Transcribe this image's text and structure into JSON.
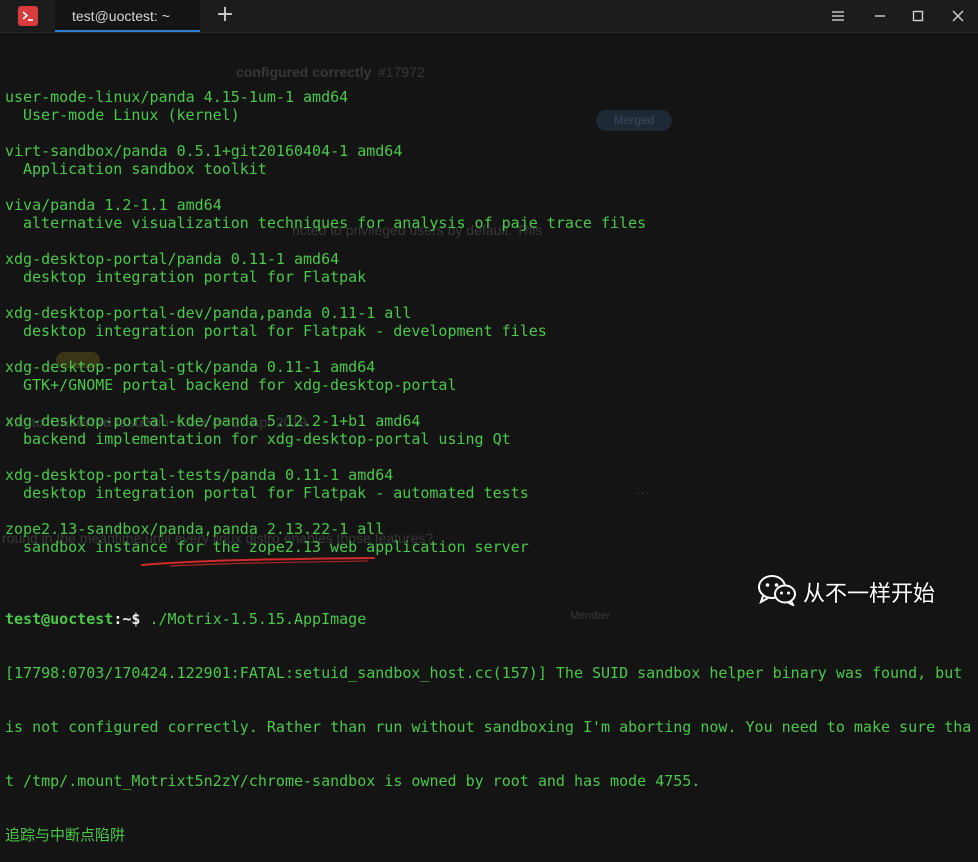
{
  "window": {
    "tab_title": "test@uoctest: ~",
    "new_tab_symbol": "+"
  },
  "background_page": {
    "issue_title_fragment": "configured correctly",
    "issue_number": "#17972",
    "merged_label": "Merged",
    "restricted_text": "ricted to privileged users by default. This",
    "tag_fragment": "5.0.x",
    "unsorted_text": "this to",
    "unsorted_bold": "Unsorted Issues",
    "in_text": "in",
    "date_text": "on 27 Apr 2019",
    "workaround_text": "round in the meantime until every linux distro enables those features?",
    "ellipsis": "···",
    "member_label": "Member"
  },
  "terminal": {
    "packages": [
      {
        "name": "user-mode-linux/panda 4.15-1um-1 amd64",
        "desc": "User-mode Linux (kernel)"
      },
      {
        "name": "virt-sandbox/panda 0.5.1+git20160404-1 amd64",
        "desc": "Application sandbox toolkit"
      },
      {
        "name": "viva/panda 1.2-1.1 amd64",
        "desc": "alternative visualization techniques for analysis of paje trace files"
      },
      {
        "name": "xdg-desktop-portal/panda 0.11-1 amd64",
        "desc": "desktop integration portal for Flatpak"
      },
      {
        "name": "xdg-desktop-portal-dev/panda,panda 0.11-1 all",
        "desc": "desktop integration portal for Flatpak - development files"
      },
      {
        "name": "xdg-desktop-portal-gtk/panda 0.11-1 amd64",
        "desc": "GTK+/GNOME portal backend for xdg-desktop-portal"
      },
      {
        "name": "xdg-desktop-portal-kde/panda 5.12.2-1+b1 amd64",
        "desc": "backend implementation for xdg-desktop-portal using Qt"
      },
      {
        "name": "xdg-desktop-portal-tests/panda 0.11-1 amd64",
        "desc": "desktop integration portal for Flatpak - automated tests"
      },
      {
        "name": "zope2.13-sandbox/panda,panda 2.13.22-1 all",
        "desc": "sandbox instance for the zope2.13 web application server"
      }
    ],
    "prompt_user": "test@uoctest",
    "prompt_rest": ":~$ ",
    "command": "./Motrix-1.5.15.AppImage",
    "error_lines": [
      "[17798:0703/170424.122901:FATAL:setuid_sandbox_host.cc(157)] The SUID sandbox helper binary was found, but",
      "is not configured correctly. Rather than run without sandboxing I'm aborting now. You need to make sure tha",
      "t /tmp/.mount_Motrixt5n2zY/chrome-sandbox is owned by root and has mode 4755.",
      "追踪与中断点陷阱"
    ]
  },
  "watermark": {
    "text": "从不一样开始"
  },
  "colors": {
    "terminal_green": "#49c849",
    "tab_accent": "#2f7fd3",
    "app_icon_red": "#d83b3b",
    "underline_red": "#d22a2a"
  }
}
